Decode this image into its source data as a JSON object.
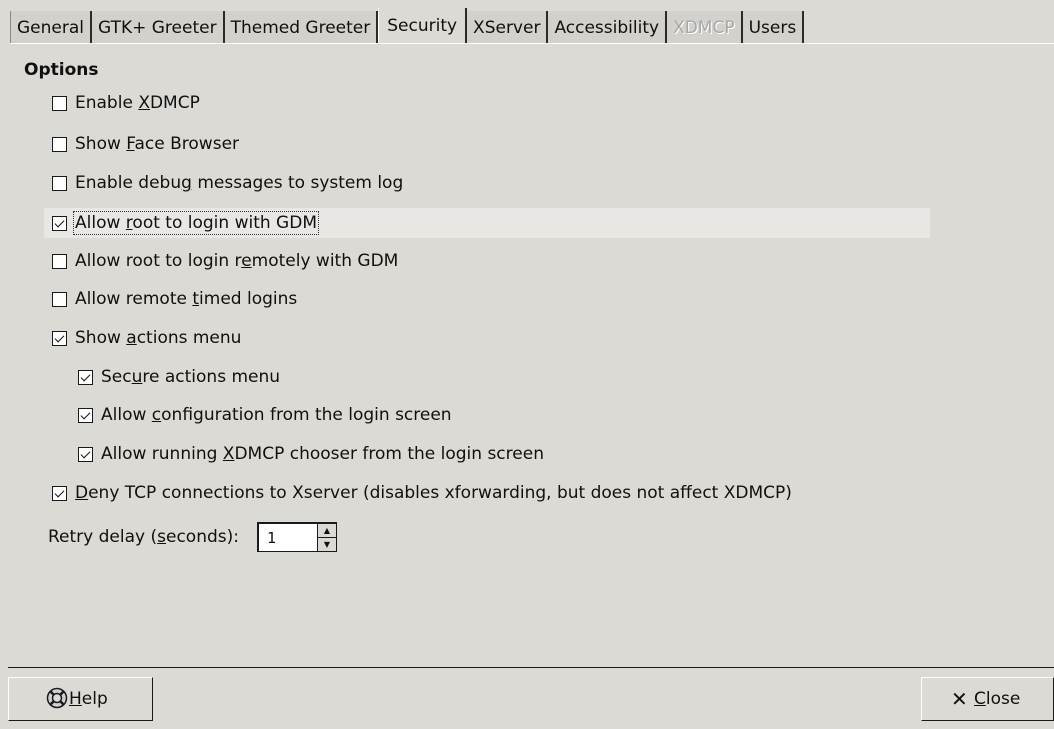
{
  "tabs": [
    {
      "label": "General"
    },
    {
      "label": "GTK+ Greeter"
    },
    {
      "label": "Themed Greeter"
    },
    {
      "label": "Security"
    },
    {
      "label": "XServer"
    },
    {
      "label": "Accessibility"
    },
    {
      "label": "XDMCP"
    },
    {
      "label": "Users"
    }
  ],
  "active_tab": "Security",
  "disabled_tab": "XDMCP",
  "options": {
    "title": "Options",
    "items": [
      {
        "pre": "Enable ",
        "u": "X",
        "post": "DMCP",
        "checked": false
      },
      {
        "pre": "Show ",
        "u": "F",
        "post": "ace Browser",
        "checked": false
      },
      {
        "pre": "Enable debu",
        "u": "g",
        "post": " messages to system log",
        "checked": false
      },
      {
        "pre": "Allow ",
        "u": "r",
        "post": "oot to login with GDM",
        "checked": true
      },
      {
        "pre": "Allow root to login r",
        "u": "e",
        "post": "motely with GDM",
        "checked": false
      },
      {
        "pre": "Allow remote ",
        "u": "t",
        "post": "imed logins",
        "checked": false
      },
      {
        "pre": "Show ",
        "u": "a",
        "post": "ctions menu",
        "checked": true
      },
      {
        "pre": "Sec",
        "u": "u",
        "post": "re actions menu",
        "checked": true
      },
      {
        "pre": "Allow ",
        "u": "c",
        "post": "onfiguration from the login screen",
        "checked": true
      },
      {
        "pre": "Allow running ",
        "u": "X",
        "post": "DMCP chooser from the login screen",
        "checked": true
      },
      {
        "pre": "",
        "u": "D",
        "post": "eny TCP connections to Xserver (disables xforwarding, but does not affect XDMCP)",
        "checked": true
      }
    ]
  },
  "retry": {
    "pre": "Retry delay (",
    "u": "s",
    "post": "econds):",
    "value": "1"
  },
  "buttons": {
    "help": {
      "u": "H",
      "post": "elp"
    },
    "close": {
      "u": "C",
      "post": "lose"
    }
  }
}
